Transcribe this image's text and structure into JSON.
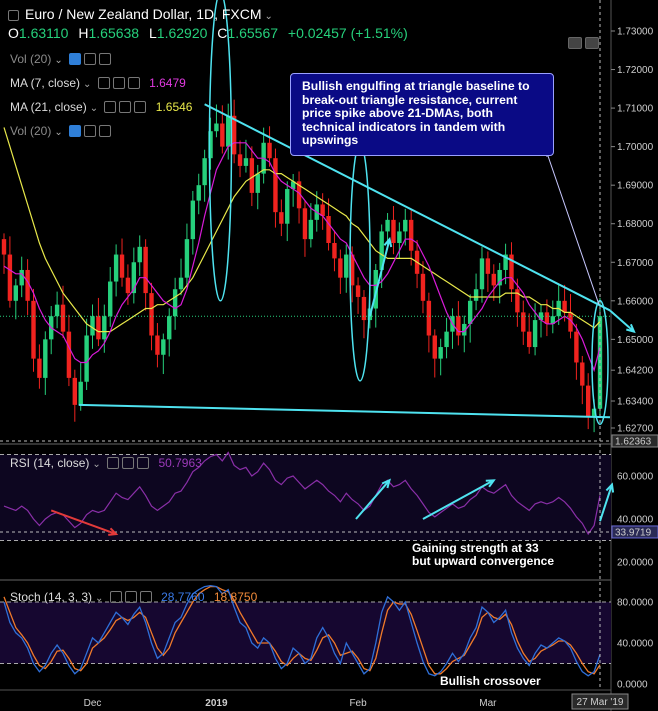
{
  "header": {
    "title": "Euro / New Zealand Dollar, 1D, FXCM",
    "ohlc": [
      {
        "k": "O",
        "v": "1.63110"
      },
      {
        "k": "H",
        "v": "1.65638"
      },
      {
        "k": "L",
        "v": "1.62920"
      },
      {
        "k": "C",
        "v": "1.65567"
      }
    ],
    "change": "+0.02457 (+1.51%)"
  },
  "indicators": {
    "vol1": {
      "label": "Vol (20)"
    },
    "ma7": {
      "label": "MA (7, close)",
      "value": "1.6479"
    },
    "ma21": {
      "label": "MA (21, close)",
      "value": "1.6546"
    },
    "vol2": {
      "label": "Vol (20)"
    },
    "rsi": {
      "label": "RSI (14, close)",
      "value": "50.7963"
    },
    "stoch": {
      "label": "Stoch (14, 3, 3)",
      "k": "28.7760",
      "d": "18.8750"
    }
  },
  "annotations": {
    "main": "Bullish engulfing at triangle baseline to break-out triangle resistance, current price spike above 21-DMAs, both technical indicators in tandem with upswings",
    "rsi_line1": "Gaining strength at 33",
    "rsi_line2": "but upward convergence",
    "stoch": "Bullish crossover"
  },
  "colors": {
    "up": "#26d07c",
    "down": "#f0231f",
    "ma7": "#d81bd8",
    "ma21": "#e8e84a",
    "trend": "#4fe3f0",
    "rsi": "#8a2fa8",
    "stoch_k": "#2f6fd8",
    "stoch_d": "#f07a2a",
    "note_bg": "#0a0a85"
  },
  "chart_data": [
    {
      "type": "candlestick",
      "name_ref": "Euro / New Zealand Dollar, 1D, FXCM",
      "ylim": [
        1.627,
        1.733
      ],
      "price_axis": [
        "1.73000",
        "1.72000",
        "1.71000",
        "1.70000",
        "1.69000",
        "1.68000",
        "1.67000",
        "1.66000",
        "1.65000",
        "1.64200",
        "1.63400",
        "1.62700"
      ],
      "last_price_tag": "1.62363",
      "x_ticks": [
        "Dec",
        "2019",
        "Feb",
        "Mar"
      ],
      "cursor_date": "27 Mar '19",
      "close": [
        1.672,
        1.66,
        1.664,
        1.668,
        1.66,
        1.645,
        1.64,
        1.65,
        1.656,
        1.659,
        1.652,
        1.64,
        1.633,
        1.639,
        1.651,
        1.656,
        1.65,
        1.656,
        1.665,
        1.672,
        1.666,
        1.662,
        1.67,
        1.674,
        1.662,
        1.651,
        1.646,
        1.65,
        1.656,
        1.663,
        1.666,
        1.676,
        1.686,
        1.69,
        1.697,
        1.704,
        1.706,
        1.7,
        1.708,
        1.698,
        1.695,
        1.697,
        1.688,
        1.693,
        1.701,
        1.697,
        1.683,
        1.68,
        1.689,
        1.691,
        1.684,
        1.676,
        1.681,
        1.685,
        1.682,
        1.675,
        1.671,
        1.666,
        1.672,
        1.664,
        1.661,
        1.655,
        1.658,
        1.668,
        1.678,
        1.681,
        1.675,
        1.678,
        1.681,
        1.673,
        1.667,
        1.66,
        1.651,
        1.645,
        1.648,
        1.652,
        1.656,
        1.651,
        1.654,
        1.66,
        1.663,
        1.671,
        1.667,
        1.664,
        1.668,
        1.672,
        1.663,
        1.657,
        1.652,
        1.648,
        1.655,
        1.657,
        1.654,
        1.656,
        1.66,
        1.657,
        1.652,
        1.644,
        1.638,
        1.63,
        1.632,
        1.656
      ],
      "ma7": [
        1.669,
        1.668,
        1.667,
        1.667,
        1.665,
        1.662,
        1.658,
        1.655,
        1.653,
        1.652,
        1.651,
        1.648,
        1.645,
        1.644,
        1.644,
        1.646,
        1.647,
        1.649,
        1.652,
        1.656,
        1.659,
        1.661,
        1.663,
        1.666,
        1.666,
        1.664,
        1.662,
        1.66,
        1.659,
        1.658,
        1.659,
        1.663,
        1.669,
        1.675,
        1.682,
        1.688,
        1.694,
        1.697,
        1.7,
        1.701,
        1.701,
        1.701,
        1.699,
        1.697,
        1.697,
        1.696,
        1.693,
        1.691,
        1.69,
        1.689,
        1.688,
        1.686,
        1.684,
        1.683,
        1.682,
        1.68,
        1.678,
        1.676,
        1.675,
        1.672,
        1.669,
        1.666,
        1.664,
        1.664,
        1.665,
        1.667,
        1.67,
        1.673,
        1.676,
        1.676,
        1.675,
        1.672,
        1.669,
        1.665,
        1.661,
        1.657,
        1.654,
        1.652,
        1.652,
        1.654,
        1.656,
        1.658,
        1.661,
        1.663,
        1.665,
        1.666,
        1.666,
        1.664,
        1.662,
        1.659,
        1.657,
        1.655,
        1.654,
        1.654,
        1.655,
        1.656,
        1.655,
        1.653,
        1.65,
        1.646,
        1.642,
        1.648
      ],
      "ma21": [
        1.705,
        1.7,
        1.695,
        1.69,
        1.685,
        1.68,
        1.675,
        1.671,
        1.668,
        1.665,
        1.662,
        1.66,
        1.658,
        1.656,
        1.654,
        1.653,
        1.652,
        1.652,
        1.652,
        1.653,
        1.654,
        1.655,
        1.656,
        1.657,
        1.658,
        1.658,
        1.659,
        1.659,
        1.66,
        1.661,
        1.662,
        1.664,
        1.666,
        1.669,
        1.672,
        1.675,
        1.678,
        1.681,
        1.684,
        1.687,
        1.689,
        1.691,
        1.692,
        1.693,
        1.694,
        1.694,
        1.693,
        1.693,
        1.692,
        1.691,
        1.69,
        1.689,
        1.688,
        1.687,
        1.686,
        1.685,
        1.684,
        1.683,
        1.682,
        1.68,
        1.679,
        1.677,
        1.675,
        1.673,
        1.672,
        1.671,
        1.671,
        1.671,
        1.671,
        1.671,
        1.67,
        1.669,
        1.668,
        1.667,
        1.666,
        1.665,
        1.664,
        1.663,
        1.662,
        1.661,
        1.661,
        1.661,
        1.661,
        1.661,
        1.661,
        1.662,
        1.662,
        1.662,
        1.661,
        1.661,
        1.66,
        1.659,
        1.659,
        1.658,
        1.658,
        1.657,
        1.657,
        1.656,
        1.655,
        1.654,
        1.653,
        1.6546
      ]
    },
    {
      "type": "line",
      "name_ref": "RSI (14, close)",
      "ylim": [
        0,
        80
      ],
      "axis": [
        "60.0000",
        "40.0000",
        "20.0000"
      ],
      "tag": "33.9719",
      "values": [
        46,
        45,
        44,
        46,
        44,
        40,
        37,
        40,
        42,
        43,
        42,
        39,
        36,
        38,
        42,
        44,
        43,
        44,
        48,
        52,
        50,
        49,
        52,
        55,
        51,
        46,
        44,
        46,
        48,
        52,
        53,
        57,
        62,
        64,
        67,
        69,
        70,
        67,
        71,
        65,
        63,
        64,
        60,
        62,
        66,
        63,
        58,
        56,
        59,
        60,
        57,
        54,
        56,
        58,
        56,
        53,
        51,
        48,
        52,
        49,
        47,
        44,
        46,
        51,
        56,
        58,
        55,
        56,
        58,
        54,
        51,
        47,
        43,
        41,
        43,
        45,
        47,
        45,
        46,
        49,
        51,
        55,
        53,
        52,
        54,
        56,
        51,
        48,
        46,
        44,
        47,
        48,
        47,
        48,
        50,
        48,
        45,
        41,
        38,
        33,
        37,
        51
      ]
    },
    {
      "type": "line",
      "name_ref": "Stoch (14, 3, 3)",
      "ylim": [
        0,
        100
      ],
      "axis": [
        "80.0000",
        "40.0000",
        "0.0000"
      ],
      "k": [
        80,
        60,
        50,
        45,
        35,
        20,
        12,
        18,
        30,
        38,
        30,
        18,
        10,
        15,
        30,
        45,
        40,
        50,
        60,
        70,
        65,
        58,
        68,
        75,
        60,
        40,
        25,
        30,
        45,
        60,
        65,
        78,
        88,
        92,
        95,
        96,
        95,
        88,
        92,
        75,
        60,
        55,
        40,
        35,
        45,
        40,
        25,
        15,
        20,
        35,
        30,
        20,
        25,
        45,
        55,
        45,
        30,
        20,
        40,
        30,
        20,
        10,
        15,
        40,
        70,
        85,
        80,
        72,
        80,
        60,
        40,
        22,
        10,
        8,
        12,
        20,
        30,
        22,
        30,
        45,
        55,
        75,
        70,
        60,
        65,
        72,
        50,
        35,
        25,
        18,
        30,
        38,
        35,
        40,
        45,
        42,
        35,
        22,
        12,
        8,
        12,
        28.776
      ],
      "d": [
        85,
        70,
        55,
        48,
        40,
        28,
        18,
        15,
        22,
        32,
        33,
        25,
        15,
        13,
        20,
        35,
        40,
        45,
        53,
        62,
        65,
        62,
        65,
        70,
        65,
        50,
        35,
        28,
        35,
        50,
        60,
        70,
        80,
        88,
        92,
        95,
        95,
        92,
        90,
        82,
        70,
        60,
        50,
        40,
        40,
        40,
        32,
        22,
        18,
        25,
        30,
        25,
        23,
        33,
        45,
        48,
        40,
        28,
        30,
        32,
        25,
        15,
        13,
        25,
        50,
        72,
        80,
        78,
        78,
        68,
        52,
        35,
        18,
        10,
        10,
        15,
        22,
        25,
        28,
        38,
        48,
        65,
        70,
        65,
        63,
        68,
        58,
        42,
        30,
        22,
        25,
        32,
        35,
        38,
        42,
        42,
        38,
        30,
        20,
        12,
        10,
        18.875
      ]
    }
  ]
}
